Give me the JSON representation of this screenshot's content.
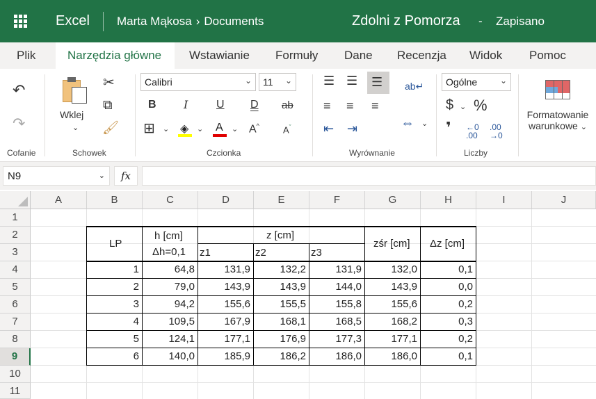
{
  "titlebar": {
    "app_name": "Excel",
    "user": "Marta Mąkosa",
    "chevron": "›",
    "folder": "Documents",
    "doc_title": "Zdolni z Pomorza",
    "dash": "-",
    "status": "Zapisano",
    "bg_color": "#217346"
  },
  "tabs": [
    "Plik",
    "Narzędzia główne",
    "Wstawianie",
    "Formuły",
    "Dane",
    "Recenzja",
    "Widok",
    "Pomoc"
  ],
  "ribbon": {
    "undo_group": "Cofanie",
    "clipboard_group": "Schowek",
    "paste_label": "Wklej",
    "font_group": "Czcionka",
    "font_name": "Calibri",
    "font_size": "11",
    "align_group": "Wyrównanie",
    "number_group": "Liczby",
    "number_format": "Ogólne",
    "cond_format_line1": "Formatowanie",
    "cond_format_line2": "warunkowe",
    "bold": "B",
    "italic": "I",
    "underline": "U",
    "double_underline": "D",
    "strike": "ab",
    "currency": "$",
    "percent": "%",
    "comma": "❜",
    "grow_font": "A",
    "shrink_font": "A",
    "font_color_letter": "A"
  },
  "formula_bar": {
    "name_box": "N9",
    "fx": "fx",
    "value": ""
  },
  "grid": {
    "columns": [
      "A",
      "B",
      "C",
      "D",
      "E",
      "F",
      "G",
      "H",
      "I",
      "J"
    ],
    "rows": [
      "1",
      "2",
      "3",
      "4",
      "5",
      "6",
      "7",
      "8",
      "9",
      "10",
      "11"
    ],
    "selected_row": "9"
  },
  "table": {
    "lp_header": "LP",
    "h_header_line1": "h [cm]",
    "h_header_line2": "Δh=0,1",
    "z_header": "z [cm]",
    "z1": "z1",
    "z2": "z2",
    "z3": "z3",
    "zsr_header": "zśr [cm]",
    "dz_header": "Δz [cm]",
    "rows": [
      {
        "lp": "1",
        "h": "64,8",
        "z1": "131,9",
        "z2": "132,2",
        "z3": "131,9",
        "zsr": "132,0",
        "dz": "0,1"
      },
      {
        "lp": "2",
        "h": "79,0",
        "z1": "143,9",
        "z2": "143,9",
        "z3": "144,0",
        "zsr": "143,9",
        "dz": "0,0"
      },
      {
        "lp": "3",
        "h": "94,2",
        "z1": "155,6",
        "z2": "155,5",
        "z3": "155,8",
        "zsr": "155,6",
        "dz": "0,2"
      },
      {
        "lp": "4",
        "h": "109,5",
        "z1": "167,9",
        "z2": "168,1",
        "z3": "168,5",
        "zsr": "168,2",
        "dz": "0,3"
      },
      {
        "lp": "5",
        "h": "124,1",
        "z1": "177,1",
        "z2": "176,9",
        "z3": "177,3",
        "zsr": "177,1",
        "dz": "0,2"
      },
      {
        "lp": "6",
        "h": "140,0",
        "z1": "185,9",
        "z2": "186,2",
        "z3": "186,0",
        "zsr": "186,0",
        "dz": "0,1"
      }
    ]
  }
}
